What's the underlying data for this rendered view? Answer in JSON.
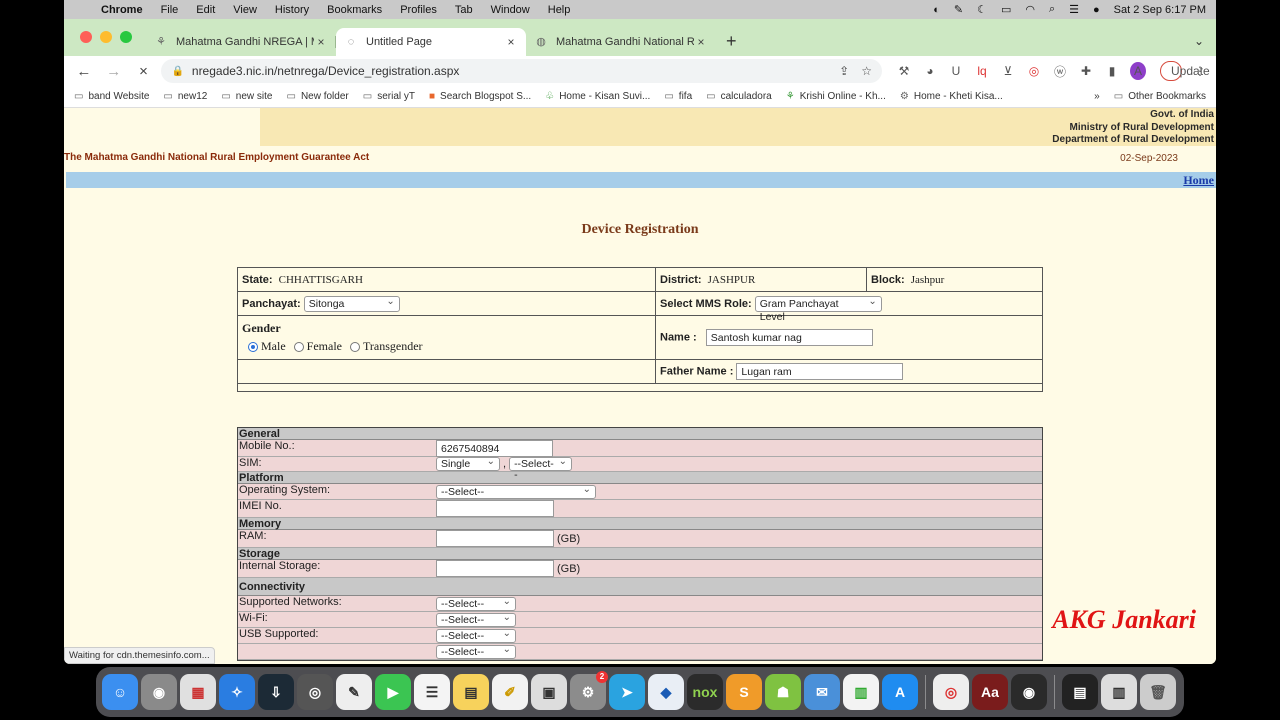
{
  "menubar": {
    "items": [
      "Chrome",
      "File",
      "Edit",
      "View",
      "History",
      "Bookmarks",
      "Profiles",
      "Tab",
      "Window",
      "Help"
    ],
    "clock": "Sat 2 Sep  6:17 PM"
  },
  "tabs": [
    {
      "label": "Mahatma Gandhi NREGA | Mini",
      "icon": "emblem-icon"
    },
    {
      "label": "Untitled Page",
      "icon": "loading-icon"
    },
    {
      "label": "Mahatma Gandhi National Rura",
      "icon": "globe-icon"
    }
  ],
  "toolbar": {
    "url": "nregade3.nic.in/netnrega/Device_registration.aspx",
    "update_label": "Update",
    "avatar_letter": "A"
  },
  "bookmarks": [
    "band Website",
    "new12",
    "new site",
    "New folder",
    "serial yT",
    "Search Blogspot S...",
    "Home - Kisan Suvi...",
    "fifa",
    "calculadora",
    "Krishi Online - Kh...",
    "Home - Kheti Kisa..."
  ],
  "bookmarks_more": "»",
  "other_bookmarks": "Other Bookmarks",
  "header": {
    "govt_line1": "Govt. of India",
    "govt_line2": "Ministry of Rural Development",
    "govt_line3": "Department of Rural Development",
    "act_title": "The Mahatma Gandhi National Rural Employment Guarantee Act",
    "date": "02-Sep-2023",
    "home_link": "Home"
  },
  "page_title": "Device Registration",
  "form": {
    "state_label": "State:",
    "state_value": "CHHATTISGARH",
    "district_label": "District:",
    "district_value": "JASHPUR",
    "block_label": "Block:",
    "block_value": "Jashpur",
    "panchayat_label": "Panchayat:",
    "panchayat_value": "Sitonga",
    "mms_role_label": "Select MMS Role:",
    "mms_role_value": "Gram Panchayat Level",
    "gender_label": "Gender",
    "gender_options": [
      "Male",
      "Female",
      "Transgender"
    ],
    "gender_selected": "Male",
    "name_label": "Name :",
    "name_value": "Santosh kumar nag",
    "father_label": "Father Name :",
    "father_value": "Lugan ram"
  },
  "spec": {
    "general": "General",
    "mobile_label": "Mobile No.:",
    "mobile_value": "6267540894",
    "sim_label": "SIM:",
    "sim_value": "Single",
    "sim_second": "--Select--",
    "sim_comma": ",",
    "platform": "Platform",
    "os_label": "Operating System:",
    "os_value": "--Select--",
    "imei_label": "IMEI No.",
    "memory": "Memory",
    "ram_label": "RAM:",
    "gb": "(GB)",
    "storage": "Storage",
    "internal_label": "Internal Storage:",
    "connectivity": "Connectivity",
    "networks_label": "Supported Networks:",
    "wifi_label": "Wi-Fi:",
    "usb_label": "USB Supported:",
    "select": "--Select--"
  },
  "status_text": "Waiting for cdn.themesinfo.com...",
  "watermark": "AKG Jankari",
  "dock_badge": "2",
  "colors": {
    "tabbar": "#cde8c3",
    "page_bg": "#fffbe6",
    "bluebar": "#a6cde9",
    "spec_row": "#efd6d6",
    "watermark": "#e01414"
  }
}
